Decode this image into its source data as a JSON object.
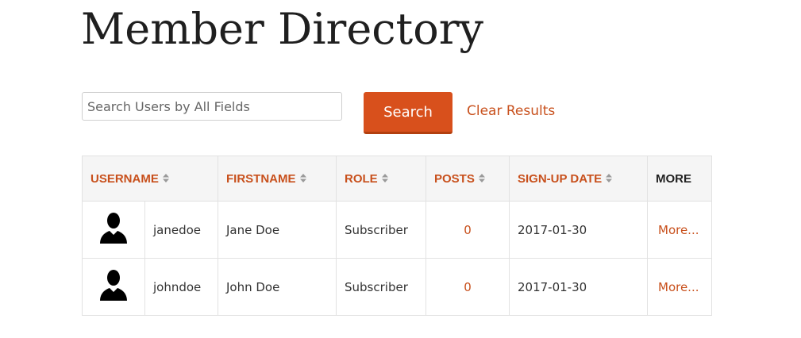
{
  "page": {
    "title": "Member Directory"
  },
  "search": {
    "placeholder": "Search Users by All Fields",
    "value": "",
    "button_label": "Search",
    "clear_label": "Clear Results"
  },
  "table": {
    "columns": [
      {
        "label": "USERNAME",
        "sortable": true
      },
      {
        "label": "FIRSTNAME",
        "sortable": true
      },
      {
        "label": "ROLE",
        "sortable": true
      },
      {
        "label": "POSTS",
        "sortable": true
      },
      {
        "label": "SIGN-UP DATE",
        "sortable": true
      },
      {
        "label": "MORE",
        "sortable": false
      }
    ],
    "rows": [
      {
        "username": "janedoe",
        "firstname": "Jane Doe",
        "role": "Subscriber",
        "posts": "0",
        "signup": "2017-01-30",
        "more": "More..."
      },
      {
        "username": "johndoe",
        "firstname": "John Doe",
        "role": "Subscriber",
        "posts": "0",
        "signup": "2017-01-30",
        "more": "More..."
      }
    ]
  },
  "icons": {
    "avatar": "user-silhouette-icon",
    "sort": "sort-up-down-icon"
  },
  "colors": {
    "accent": "#c8501c",
    "button": "#d8501c",
    "header_bg": "#f5f5f5"
  }
}
